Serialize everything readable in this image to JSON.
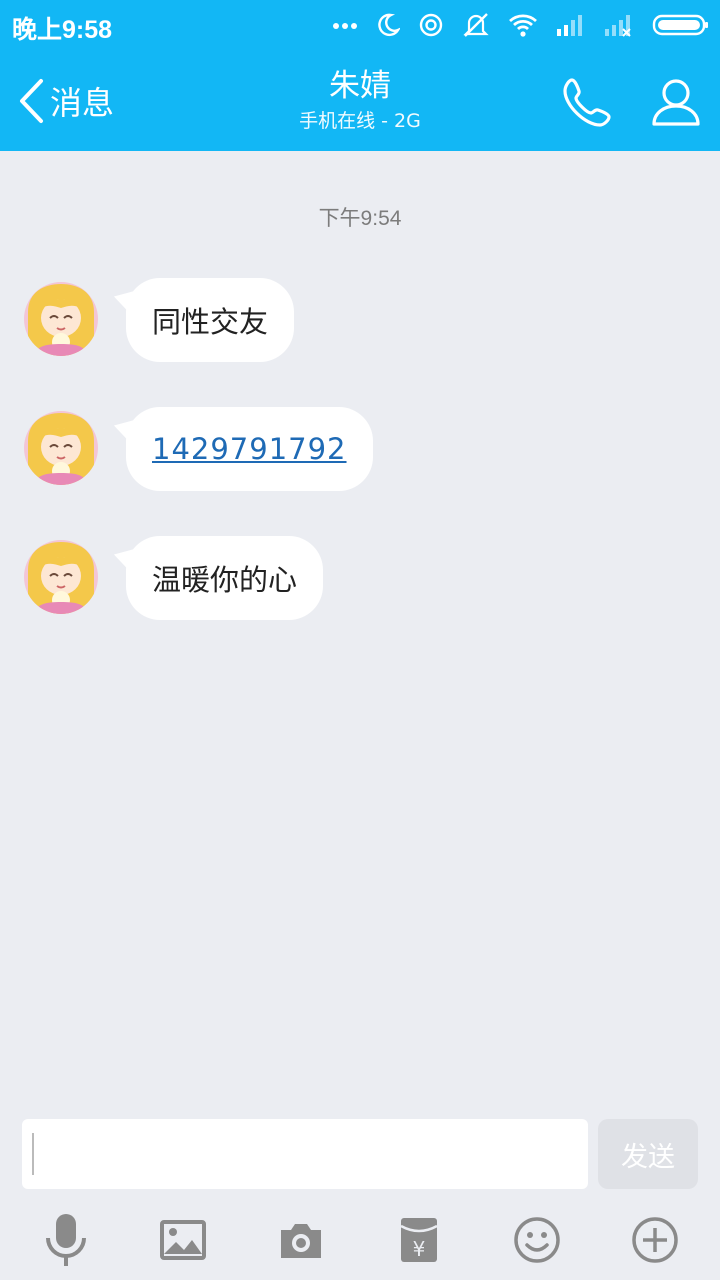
{
  "status_bar": {
    "time": "晚上9:58",
    "icons": [
      "more-dots-icon",
      "moon-icon",
      "sync-icon",
      "mute-icon",
      "wifi-icon",
      "signal-icon",
      "signal-no-sim-icon",
      "battery-icon"
    ]
  },
  "header": {
    "back_label": "消息",
    "title": "朱婧",
    "subtitle": "手机在线 - 2G"
  },
  "chat": {
    "timestamp": "下午9:54",
    "messages": [
      {
        "text": "同性交友",
        "type": "text"
      },
      {
        "text": "1429791792",
        "type": "link"
      },
      {
        "text": "温暖你的心",
        "type": "text"
      }
    ]
  },
  "composer": {
    "input_value": "",
    "send_label": "发送"
  },
  "toolbar": {
    "items": [
      "microphone-icon",
      "image-icon",
      "camera-icon",
      "red-packet-icon",
      "emoji-icon",
      "plus-icon"
    ]
  },
  "colors": {
    "accent": "#12b7f5",
    "background": "#ebedf2",
    "link": "#1e6ab5",
    "icon_gray": "#8a8a8a"
  }
}
